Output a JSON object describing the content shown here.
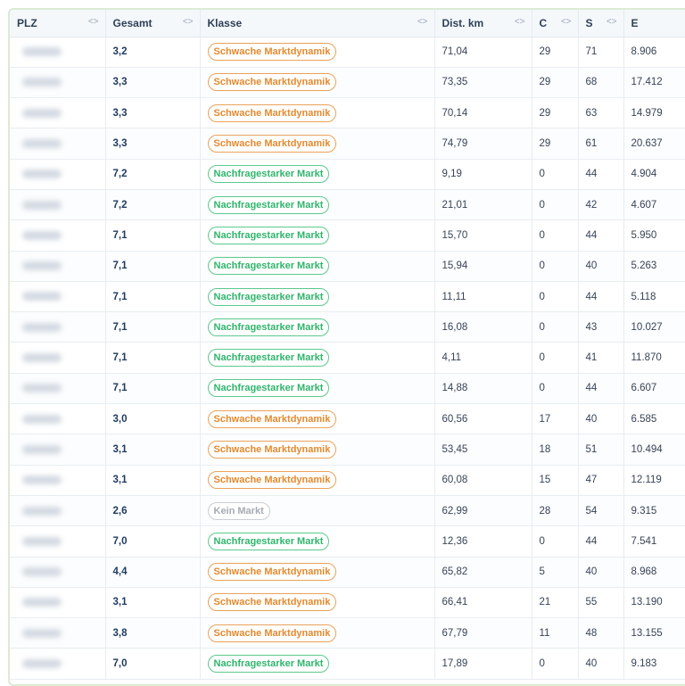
{
  "columns": [
    {
      "label": "PLZ",
      "sort_icon": "sort-arrows-icon"
    },
    {
      "label": "Gesamt",
      "sort_icon": "sort-arrows-icon"
    },
    {
      "label": "Klasse",
      "sort_icon": "sort-arrows-icon"
    },
    {
      "label": "Dist. km",
      "sort_icon": "sort-arrows-icon"
    },
    {
      "label": "C",
      "sort_icon": "sort-arrows-icon"
    },
    {
      "label": "S",
      "sort_icon": "sort-arrows-icon"
    },
    {
      "label": "E",
      "sort_icon": "sort-arrows-icon"
    }
  ],
  "sort_glyph": "<>",
  "badge_colors": {
    "schwach": "#e38a2e",
    "nachfrage": "#2fb56c",
    "kein": "#a5abb3"
  },
  "rows": [
    {
      "gesamt": "3,2",
      "klasse": "Schwache Marktdynamik",
      "kind": "schwach",
      "dist": "71,04",
      "c": "29",
      "s": "71",
      "e": "8.906"
    },
    {
      "gesamt": "3,3",
      "klasse": "Schwache Marktdynamik",
      "kind": "schwach",
      "dist": "73,35",
      "c": "29",
      "s": "68",
      "e": "17.412"
    },
    {
      "gesamt": "3,3",
      "klasse": "Schwache Marktdynamik",
      "kind": "schwach",
      "dist": "70,14",
      "c": "29",
      "s": "63",
      "e": "14.979"
    },
    {
      "gesamt": "3,3",
      "klasse": "Schwache Marktdynamik",
      "kind": "schwach",
      "dist": "74,79",
      "c": "29",
      "s": "61",
      "e": "20.637"
    },
    {
      "gesamt": "7,2",
      "klasse": "Nachfragestarker Markt",
      "kind": "nachfrage",
      "dist": "9,19",
      "c": "0",
      "s": "44",
      "e": "4.904"
    },
    {
      "gesamt": "7,2",
      "klasse": "Nachfragestarker Markt",
      "kind": "nachfrage",
      "dist": "21,01",
      "c": "0",
      "s": "42",
      "e": "4.607"
    },
    {
      "gesamt": "7,1",
      "klasse": "Nachfragestarker Markt",
      "kind": "nachfrage",
      "dist": "15,70",
      "c": "0",
      "s": "44",
      "e": "5.950"
    },
    {
      "gesamt": "7,1",
      "klasse": "Nachfragestarker Markt",
      "kind": "nachfrage",
      "dist": "15,94",
      "c": "0",
      "s": "40",
      "e": "5.263"
    },
    {
      "gesamt": "7,1",
      "klasse": "Nachfragestarker Markt",
      "kind": "nachfrage",
      "dist": "11,11",
      "c": "0",
      "s": "44",
      "e": "5.118"
    },
    {
      "gesamt": "7,1",
      "klasse": "Nachfragestarker Markt",
      "kind": "nachfrage",
      "dist": "16,08",
      "c": "0",
      "s": "43",
      "e": "10.027"
    },
    {
      "gesamt": "7,1",
      "klasse": "Nachfragestarker Markt",
      "kind": "nachfrage",
      "dist": "4,11",
      "c": "0",
      "s": "41",
      "e": "11.870"
    },
    {
      "gesamt": "7,1",
      "klasse": "Nachfragestarker Markt",
      "kind": "nachfrage",
      "dist": "14,88",
      "c": "0",
      "s": "44",
      "e": "6.607"
    },
    {
      "gesamt": "3,0",
      "klasse": "Schwache Marktdynamik",
      "kind": "schwach",
      "dist": "60,56",
      "c": "17",
      "s": "40",
      "e": "6.585"
    },
    {
      "gesamt": "3,1",
      "klasse": "Schwache Marktdynamik",
      "kind": "schwach",
      "dist": "53,45",
      "c": "18",
      "s": "51",
      "e": "10.494"
    },
    {
      "gesamt": "3,1",
      "klasse": "Schwache Marktdynamik",
      "kind": "schwach",
      "dist": "60,08",
      "c": "15",
      "s": "47",
      "e": "12.119"
    },
    {
      "gesamt": "2,6",
      "klasse": "Kein Markt",
      "kind": "kein",
      "dist": "62,99",
      "c": "28",
      "s": "54",
      "e": "9.315"
    },
    {
      "gesamt": "7,0",
      "klasse": "Nachfragestarker Markt",
      "kind": "nachfrage",
      "dist": "12,36",
      "c": "0",
      "s": "44",
      "e": "7.541"
    },
    {
      "gesamt": "4,4",
      "klasse": "Schwache Marktdynamik",
      "kind": "schwach",
      "dist": "65,82",
      "c": "5",
      "s": "40",
      "e": "8.968"
    },
    {
      "gesamt": "3,1",
      "klasse": "Schwache Marktdynamik",
      "kind": "schwach",
      "dist": "66,41",
      "c": "21",
      "s": "55",
      "e": "13.190"
    },
    {
      "gesamt": "3,8",
      "klasse": "Schwache Marktdynamik",
      "kind": "schwach",
      "dist": "67,79",
      "c": "11",
      "s": "48",
      "e": "13.155"
    },
    {
      "gesamt": "7,0",
      "klasse": "Nachfragestarker Markt",
      "kind": "nachfrage",
      "dist": "17,89",
      "c": "0",
      "s": "40",
      "e": "9.183"
    }
  ]
}
